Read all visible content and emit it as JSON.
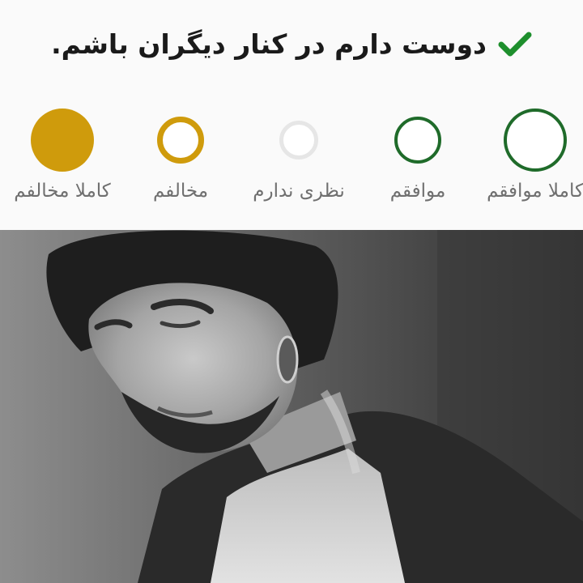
{
  "statement": {
    "text": "دوست دارم در کنار دیگران باشم.",
    "check_icon": "checkmark-icon",
    "check_color": "#1e8f2d"
  },
  "options": [
    {
      "label": "کاملا موافقم",
      "selected": false,
      "ring_color": "#1f6b2a"
    },
    {
      "label": "موافقم",
      "selected": false,
      "ring_color": "#1f6b2a"
    },
    {
      "label": "نظری ندارم",
      "selected": false,
      "ring_color": "#e6e6e6"
    },
    {
      "label": "مخالفم",
      "selected": false,
      "ring_color": "#cf9b0c"
    },
    {
      "label": "کاملا مخالفم",
      "selected": true,
      "ring_color": "#cf9b0c"
    }
  ],
  "colors": {
    "agree": "#1f6b2a",
    "neutral": "#e6e6e6",
    "disagree": "#cf9b0c",
    "label_text": "#6f6f6f",
    "panel_bg": "#fafafa"
  },
  "photo": {
    "subject": "black-and-white portrait of a bearded man with long hair"
  }
}
